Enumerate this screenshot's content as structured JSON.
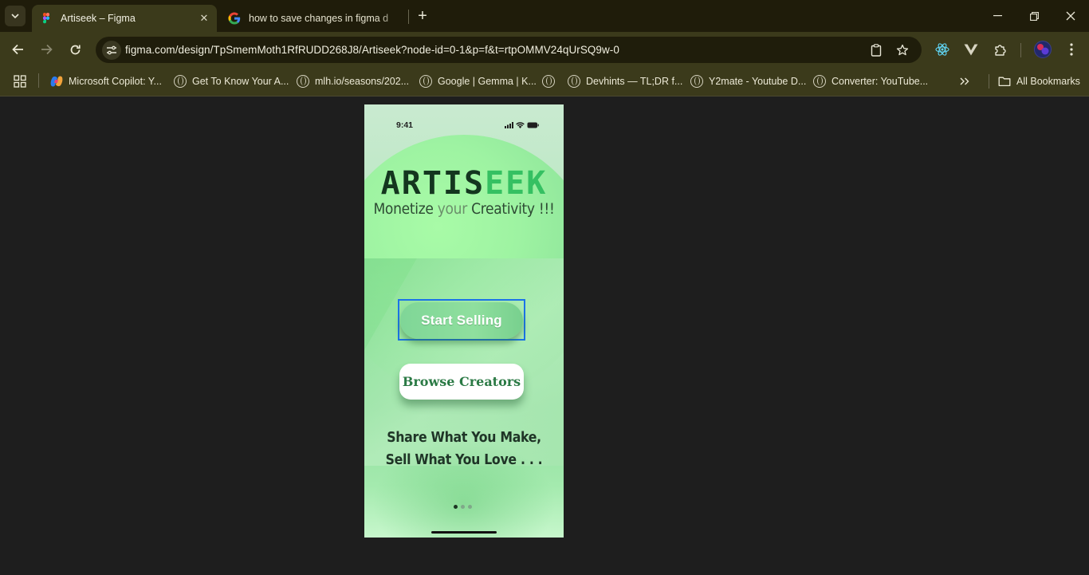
{
  "browser": {
    "tabs": [
      {
        "title": "Artiseek – Figma",
        "active": true,
        "favicon": "figma-icon"
      },
      {
        "title": "how to save changes in figma d",
        "active": false,
        "favicon": "google-icon"
      }
    ],
    "url": "figma.com/design/TpSmemMoth1RfRUDD268J8/Artiseek?node-id=0-1&p=f&t=rtpOMMV24qUrSQ9w-0",
    "bookmarks": [
      {
        "label": "Microsoft Copilot: Y...",
        "icon": "copilot-icon"
      },
      {
        "label": "Get To Know Your A...",
        "icon": "globe-icon"
      },
      {
        "label": "mlh.io/seasons/202...",
        "icon": "globe-icon"
      },
      {
        "label": "Google | Gemma | K...",
        "icon": "globe-icon"
      },
      {
        "label": "",
        "icon": "globe-icon"
      },
      {
        "label": "Devhints — TL;DR f...",
        "icon": "globe-icon"
      },
      {
        "label": "Y2mate - Youtube D...",
        "icon": "globe-icon"
      },
      {
        "label": "Converter: YouTube...",
        "icon": "globe-icon"
      }
    ],
    "all_bookmarks_label": "All Bookmarks"
  },
  "phone": {
    "status_time": "9:41",
    "brand_dark": "ARTIS",
    "brand_light": "EEK",
    "tagline_a": "Monetize ",
    "tagline_b": "your ",
    "tagline_c": "Creativity !!!",
    "start_selling": "Start Selling",
    "browse_creators": "Browse Creators",
    "slogan": "Share What You Make, Sell What You Love . . .",
    "page_count": 3,
    "active_page": 1
  },
  "colors": {
    "accent_selection": "#1b73e8",
    "brand_dark": "#14361f",
    "brand_light": "#35c062",
    "browse_text": "#2b7a45"
  }
}
